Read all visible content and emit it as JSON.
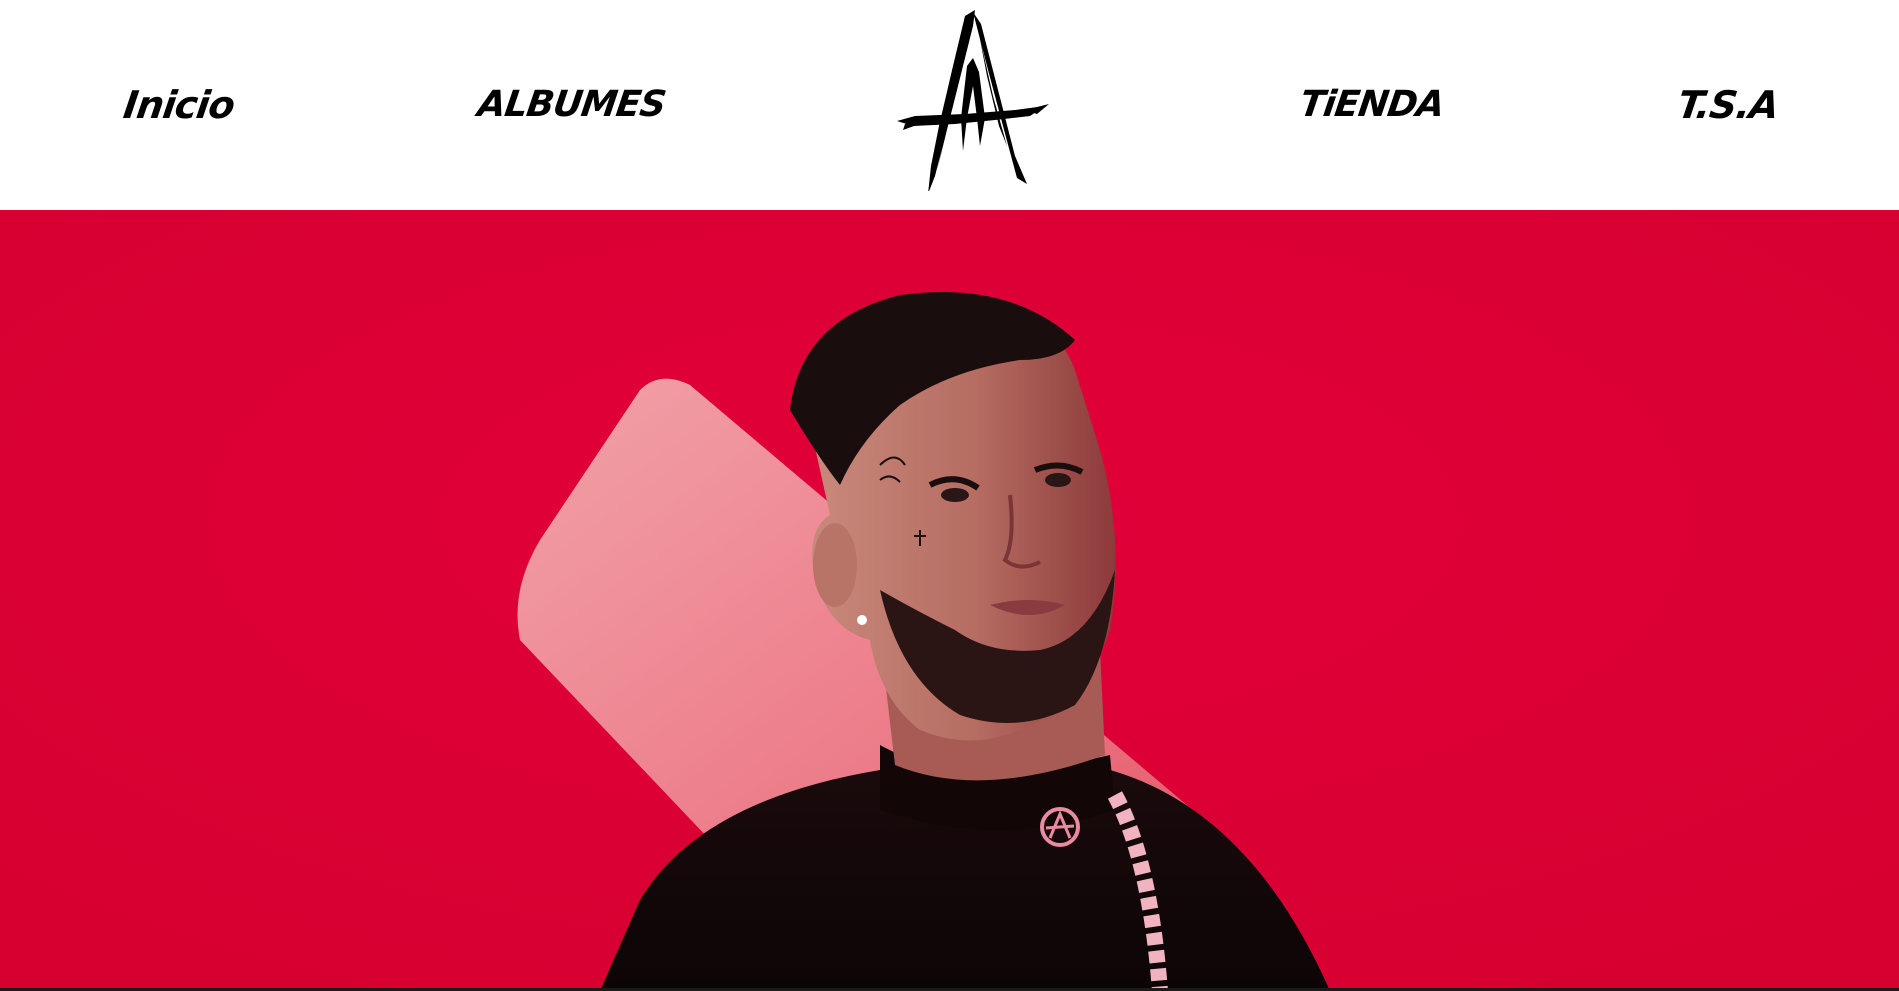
{
  "nav": {
    "left": [
      {
        "label": "Inicio"
      },
      {
        "label": "ALBUMES"
      }
    ],
    "right": [
      {
        "label": "TiENDA"
      },
      {
        "label": "T.S.A"
      }
    ],
    "logo_icon": "anuel-a-logo-icon"
  },
  "hero": {
    "background_color": "#dc0032",
    "image": "artist-portrait-image"
  }
}
